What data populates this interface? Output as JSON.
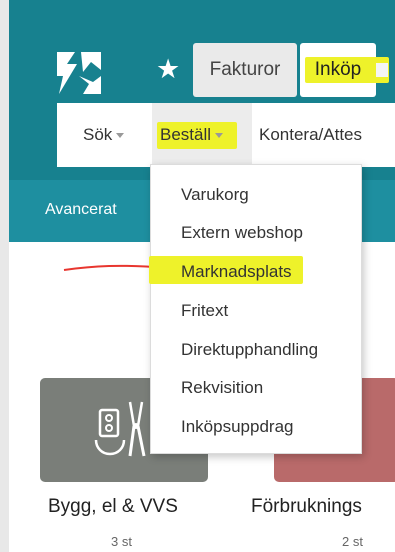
{
  "header": {
    "tabs": [
      {
        "label": "Fakturor"
      },
      {
        "label": "Inköp"
      }
    ]
  },
  "submenu": {
    "items": [
      {
        "label": "Sök"
      },
      {
        "label": "Beställ"
      },
      {
        "label": "Kontera/Attes"
      }
    ]
  },
  "band": {
    "label": "Avancerat"
  },
  "dropdown": {
    "items": [
      {
        "label": "Varukorg"
      },
      {
        "label": "Extern webshop"
      },
      {
        "label": "Marknadsplats"
      },
      {
        "label": "Fritext"
      },
      {
        "label": "Direktupphandling"
      },
      {
        "label": "Rekvisition"
      },
      {
        "label": "Inköpsuppdrag"
      }
    ]
  },
  "categories": [
    {
      "title": "Bygg, el & VVS",
      "count": "3 st"
    },
    {
      "title": "Förbruknings",
      "count": "2 st"
    }
  ],
  "colors": {
    "header": "#17818f",
    "band": "#1e8fa0",
    "highlight": "#eef22a",
    "annotation_arrow": "#e8362f"
  },
  "icons": [
    "logo-icon",
    "star-icon",
    "tools-icon",
    "red-arrow-annotation"
  ]
}
